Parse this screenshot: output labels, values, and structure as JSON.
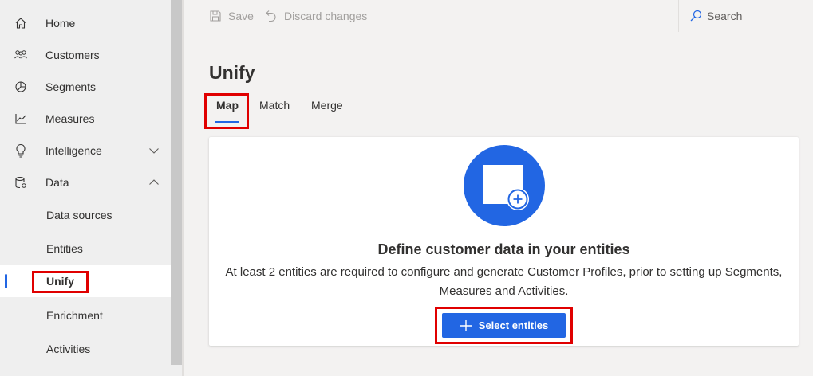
{
  "sidebar": {
    "items": [
      {
        "label": "Home",
        "icon": "home-icon"
      },
      {
        "label": "Customers",
        "icon": "customers-icon"
      },
      {
        "label": "Segments",
        "icon": "segments-icon"
      },
      {
        "label": "Measures",
        "icon": "measures-icon"
      },
      {
        "label": "Intelligence",
        "icon": "intelligence-icon",
        "expandable": true,
        "expanded": false
      },
      {
        "label": "Data",
        "icon": "data-icon",
        "expandable": true,
        "expanded": true
      }
    ],
    "sub_items": [
      {
        "label": "Data sources"
      },
      {
        "label": "Entities"
      },
      {
        "label": "Unify",
        "active": true
      },
      {
        "label": "Enrichment"
      },
      {
        "label": "Activities"
      }
    ]
  },
  "toolbar": {
    "save_label": "Save",
    "discard_label": "Discard changes",
    "search_label": "Search"
  },
  "page": {
    "title": "Unify",
    "tabs": [
      {
        "label": "Map",
        "active": true
      },
      {
        "label": "Match"
      },
      {
        "label": "Merge"
      }
    ]
  },
  "card": {
    "title": "Define customer data in your entities",
    "description": "At least 2 entities are required to configure and generate Customer Profiles, prior to setting up Segments, Measures and Activities.",
    "button_label": "Select entities"
  },
  "colors": {
    "accent": "#2266e3",
    "highlight": "#e00000"
  }
}
